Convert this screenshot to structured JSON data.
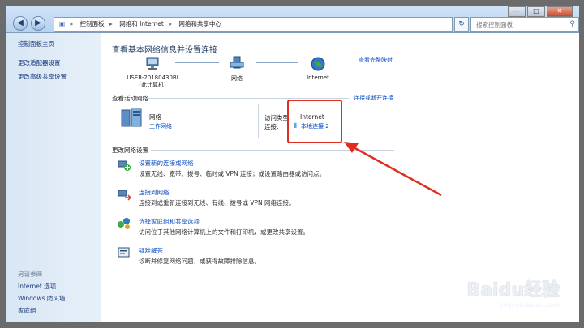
{
  "address": {
    "crumbs": [
      "控制面板",
      "网络和 Internet",
      "网络和共享中心"
    ]
  },
  "search": {
    "placeholder": "搜索控制面板"
  },
  "window_controls": {
    "minimize": "—",
    "maximize": "□",
    "close": "✕"
  },
  "sidebar": {
    "items": [
      "控制面板主页",
      "更改适配器设置",
      "更改高级共享设置"
    ],
    "see_also_label": "另请参阅",
    "see_also": [
      "Internet 选项",
      "Windows 防火墙",
      "家庭组"
    ]
  },
  "main": {
    "title": "查看基本网络信息并设置连接",
    "view_full_map": "查看完整映射",
    "map": {
      "computer_name": "USER-20180430BI",
      "computer_sub": "(此计算机)",
      "network": "网络",
      "internet": "Internet"
    },
    "active_section_label": "查看活动网络",
    "connect_disconnect": "连接或断开连接",
    "active_network": {
      "name": "网络",
      "type": "工作网络",
      "access_type_label": "访问类型:",
      "access_type_value": "Internet",
      "connection_label": "连接:",
      "connection_value": "本地连接 2"
    },
    "change_section_label": "更改网络设置",
    "tasks": [
      {
        "title": "设置新的连接或网络",
        "desc": "设置无线、宽带、拨号、临时或 VPN 连接；或设置路由器或访问点。"
      },
      {
        "title": "连接到网络",
        "desc": "连接到或重新连接到无线、有线、拨号或 VPN 网络连接。"
      },
      {
        "title": "选择家庭组和共享选项",
        "desc": "访问位于其他网络计算机上的文件和打印机，或更改共享设置。"
      },
      {
        "title": "疑难解答",
        "desc": "诊断并修复网络问题，或获得故障排除信息。"
      }
    ]
  },
  "watermark": {
    "brand": "Baidu经验",
    "url": "jingyan.baidu.com"
  },
  "colors": {
    "accent": "#0a4bbf",
    "highlight": "#e22c20"
  }
}
